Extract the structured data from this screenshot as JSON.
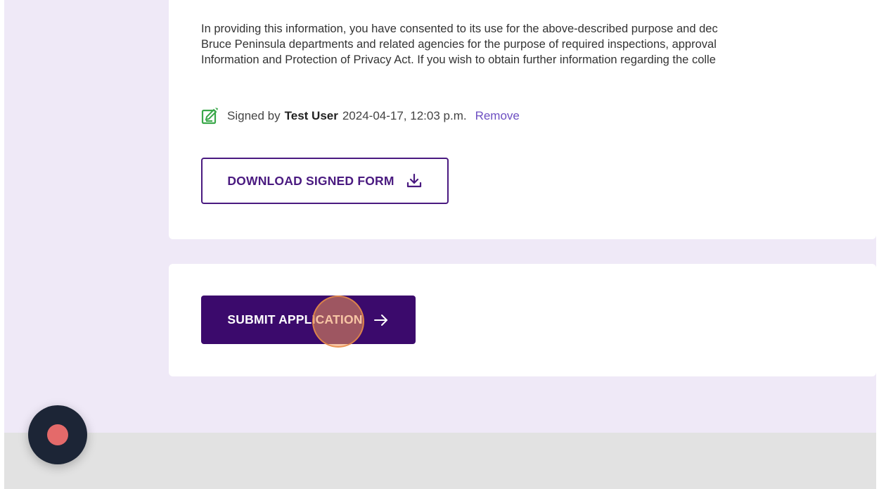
{
  "consent": {
    "lines": [
      "In providing this information, you have consented to its use for the above-described purpose and dec",
      "Bruce Peninsula departments and related agencies for the purpose of required inspections, approval",
      "Information and Protection of Privacy Act. If you wish to obtain further information regarding the colle"
    ]
  },
  "signature": {
    "prefix": "Signed by",
    "name": "Test User",
    "timestamp": "2024-04-17, 12:03 p.m.",
    "remove_label": "Remove",
    "icon": "edit-document-icon"
  },
  "download": {
    "label": "DOWNLOAD SIGNED FORM",
    "icon": "download-icon"
  },
  "submit": {
    "label": "SUBMIT APPLICATION",
    "icon": "arrow-right-icon"
  },
  "recorder": {
    "icon": "record-icon"
  },
  "colors": {
    "page_background": "#efe9f7",
    "primary": "#3b0a6c",
    "link": "#6d4fc2",
    "sign_icon": "#3aa84a",
    "record_dot": "#e46a6a"
  }
}
